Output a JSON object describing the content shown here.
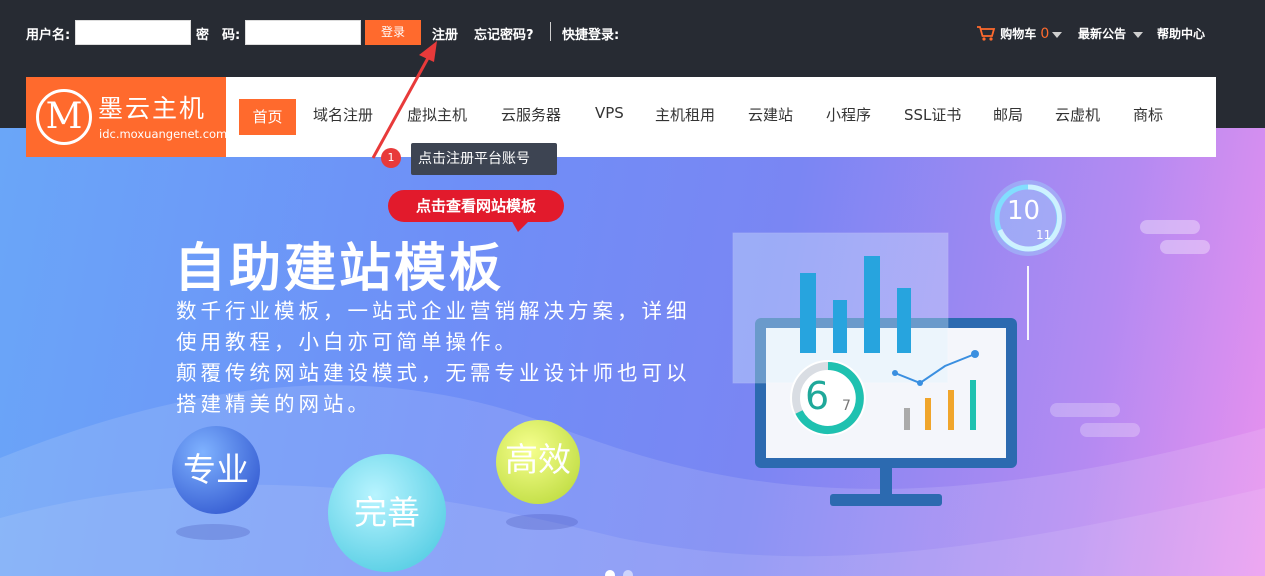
{
  "topbar": {
    "username_label": "用户名:",
    "password_label": "密　码:",
    "login_button": "登录",
    "register_link": "注册",
    "forgot_link": "忘记密码?",
    "quick_login_label": "快捷登录:",
    "cart_label": "购物车",
    "cart_count": "0",
    "announcements": "最新公告",
    "help": "帮助中心"
  },
  "logo": {
    "mark": "M",
    "name": "墨云主机",
    "domain": "idc.moxuangenet.com"
  },
  "nav": {
    "items": [
      "首页",
      "域名注册",
      "虚拟主机",
      "云服务器",
      "VPS",
      "主机租用",
      "云建站",
      "小程序",
      "SSL证书",
      "邮局",
      "云虚机",
      "商标"
    ],
    "active_index": 0
  },
  "tooltip": {
    "step": "1",
    "text": "点击注册平台账号"
  },
  "banner": {
    "cta": "点击查看网站模板",
    "title": "自助建站模板",
    "desc_lines": [
      "数千行业模板，一站式企业营销解决方案，详细",
      "使用教程，小白亦可简单操作。",
      "颠覆传统网站建设模式，无需专业设计师也可以",
      "搭建精美的网站。"
    ],
    "bubbles": [
      "专业",
      "完善",
      "高效"
    ],
    "gauge_top": {
      "value": "10",
      "total": "11"
    },
    "gauge_screen": {
      "value": "6",
      "total": "7"
    }
  },
  "colors": {
    "accent": "#ff6a2d",
    "topbar": "#272b33",
    "cta": "#e21a2c"
  }
}
